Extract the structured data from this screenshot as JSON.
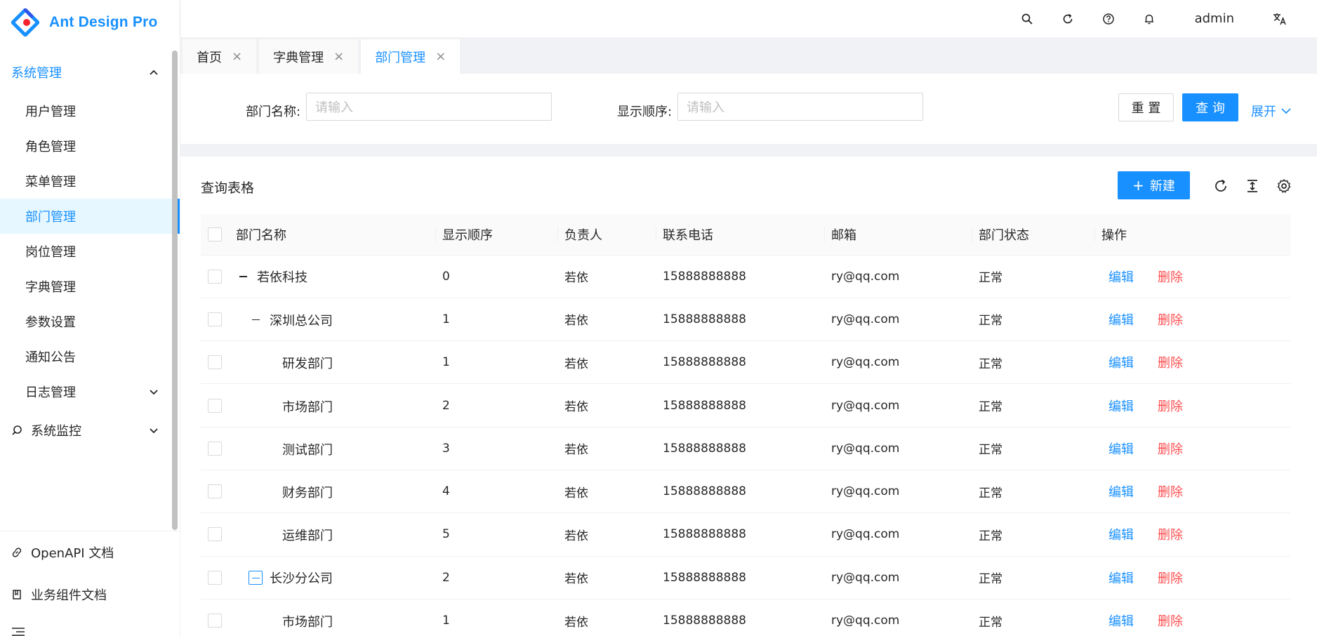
{
  "app": {
    "title": "Ant Design Pro"
  },
  "header": {
    "user": "admin"
  },
  "sidebar": {
    "group": "系统管理",
    "items": [
      "用户管理",
      "角色管理",
      "菜单管理",
      "部门管理",
      "岗位管理",
      "字典管理",
      "参数设置",
      "通知公告",
      "日志管理"
    ],
    "selected": "部门管理",
    "monitor": "系统监控",
    "links": [
      "OpenAPI 文档",
      "业务组件文档"
    ]
  },
  "tabs": [
    {
      "label": "首页",
      "active": false
    },
    {
      "label": "字典管理",
      "active": false
    },
    {
      "label": "部门管理",
      "active": true
    }
  ],
  "search": {
    "dept_name_label": "部门名称:",
    "dept_name_placeholder": "请输入",
    "order_label": "显示顺序:",
    "order_placeholder": "请输入",
    "reset": "重 置",
    "query": "查 询",
    "expand": "展开"
  },
  "table": {
    "title": "查询表格",
    "new_button": "新建",
    "columns": [
      "部门名称",
      "显示顺序",
      "负责人",
      "联系电话",
      "邮箱",
      "部门状态",
      "操作"
    ],
    "edit_label": "编辑",
    "delete_label": "删除",
    "rows": [
      {
        "name": "若依科技",
        "order": "0",
        "leader": "若依",
        "phone": "15888888888",
        "email": "ry@qq.com",
        "status": "正常"
      },
      {
        "name": "深圳总公司",
        "order": "1",
        "leader": "若依",
        "phone": "15888888888",
        "email": "ry@qq.com",
        "status": "正常"
      },
      {
        "name": "研发部门",
        "order": "1",
        "leader": "若依",
        "phone": "15888888888",
        "email": "ry@qq.com",
        "status": "正常"
      },
      {
        "name": "市场部门",
        "order": "2",
        "leader": "若依",
        "phone": "15888888888",
        "email": "ry@qq.com",
        "status": "正常"
      },
      {
        "name": "测试部门",
        "order": "3",
        "leader": "若依",
        "phone": "15888888888",
        "email": "ry@qq.com",
        "status": "正常"
      },
      {
        "name": "财务部门",
        "order": "4",
        "leader": "若依",
        "phone": "15888888888",
        "email": "ry@qq.com",
        "status": "正常"
      },
      {
        "name": "运维部门",
        "order": "5",
        "leader": "若依",
        "phone": "15888888888",
        "email": "ry@qq.com",
        "status": "正常"
      },
      {
        "name": "长沙分公司",
        "order": "2",
        "leader": "若依",
        "phone": "15888888888",
        "email": "ry@qq.com",
        "status": "正常"
      },
      {
        "name": "市场部门",
        "order": "1",
        "leader": "若依",
        "phone": "15888888888",
        "email": "ry@qq.com",
        "status": "正常"
      }
    ]
  },
  "colors": {
    "primary": "#1890ff",
    "danger": "#ff4d4f",
    "selected_bg": "#e6f7ff"
  },
  "icons": [
    "logo-icon",
    "search-icon",
    "reload-icon",
    "question-icon",
    "bell-icon",
    "translate-icon",
    "chevron-up-icon",
    "chevron-down-icon",
    "monitor-icon",
    "link-icon",
    "book-icon",
    "menu-fold-icon",
    "close-icon",
    "plus-icon",
    "column-height-icon",
    "setting-icon"
  ]
}
